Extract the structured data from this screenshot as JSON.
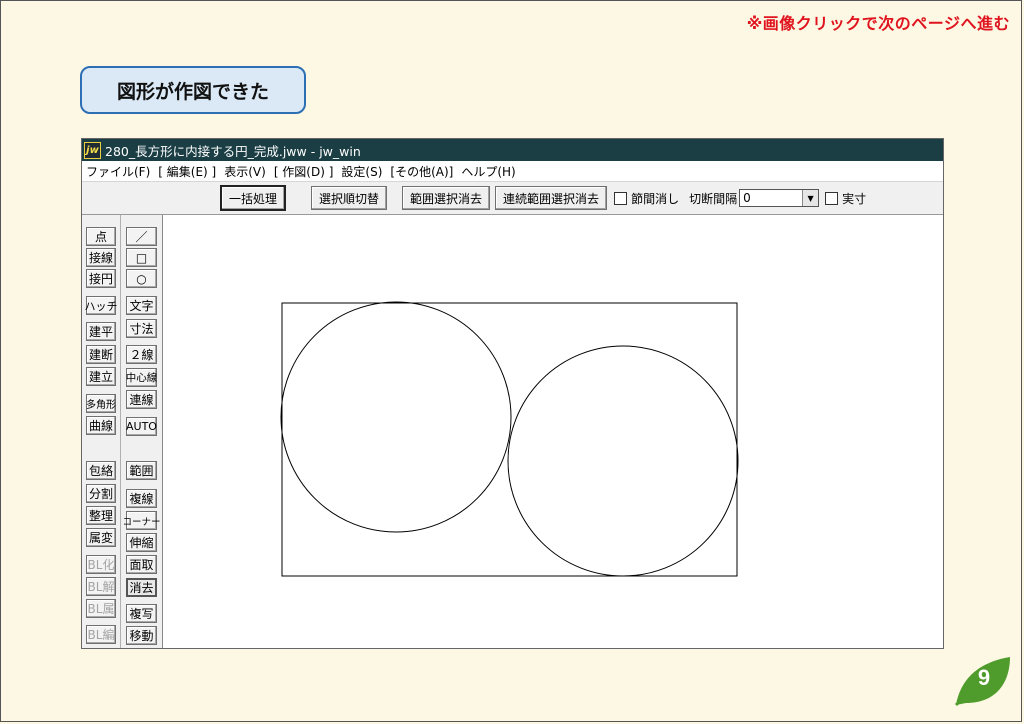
{
  "nav_hint": "※画像クリックで次のページへ進む",
  "step_title": "図形が作図できた",
  "page_number": "9",
  "window": {
    "icon_text": "jw",
    "title": "280_長方形に内接する円_完成.jww - jw_win"
  },
  "menu": [
    "ファイル(F)",
    "[ 編集(E) ]",
    "表示(V)",
    "[ 作図(D) ]",
    "設定(S)",
    "[その他(A)]",
    "ヘルプ(H)"
  ],
  "toolbar": {
    "batch": "一括処理",
    "select_order": "選択順切替",
    "clear_range": "範囲選択消去",
    "clear_continuous": "連続範囲選択消去",
    "node_erase": "節間消し",
    "cut_interval": "切断間隔",
    "cut_value": "0",
    "actual": "実寸"
  },
  "left_tools": [
    "点",
    "接線",
    "接円",
    "ハッチ",
    "建平",
    "建断",
    "建立",
    "多角形",
    "曲線",
    "包絡",
    "分割",
    "整理",
    "属変",
    "BL化",
    "BL解",
    "BL属",
    "BL編"
  ],
  "right_tools": [
    "／",
    "□",
    "○",
    "文字",
    "寸法",
    "２線",
    "中心線",
    "連線",
    "AUTO",
    "範囲",
    "複線",
    "コーナー",
    "伸縮",
    "面取",
    "消去",
    "複写",
    "移動"
  ],
  "colors": {
    "titlebar": "#1b3e45",
    "accent_red": "#e0141e",
    "step_border": "#2d6fb5",
    "leaf": "#4f9c2c"
  }
}
